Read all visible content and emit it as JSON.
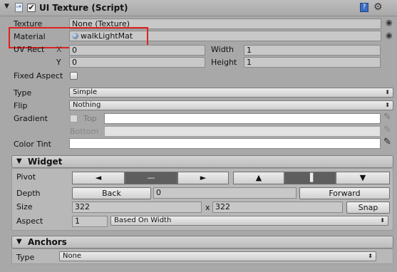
{
  "component": {
    "title": "UI Texture (Script)",
    "enabled": true,
    "icons": [
      "foldout-arrow-icon",
      "script-icon",
      "enable-checkbox",
      "help-icon",
      "settings-icon"
    ]
  },
  "texture": {
    "label": "Texture",
    "value": "None (Texture)"
  },
  "material": {
    "label": "Material",
    "value": "walkLightMat"
  },
  "uv_rect": {
    "label": "UV Rect",
    "x_label": "X",
    "x": "0",
    "y_label": "Y",
    "y": "0",
    "width_label": "Width",
    "width": "1",
    "height_label": "Height",
    "height": "1"
  },
  "fixed_aspect": {
    "label": "Fixed Aspect",
    "checked": false
  },
  "type": {
    "label": "Type",
    "value": "Simple"
  },
  "flip": {
    "label": "Flip",
    "value": "Nothing"
  },
  "gradient": {
    "label": "Gradient",
    "top_label": "Top",
    "bottom_label": "Bottom",
    "enabled": false
  },
  "color_tint": {
    "label": "Color Tint",
    "color": "#ffffff"
  },
  "widget": {
    "title": "Widget",
    "pivot_label": "Pivot",
    "pivot_h_left": "◄",
    "pivot_h_center": "—",
    "pivot_h_right": "►",
    "pivot_v_top": "▲",
    "pivot_v_middle": "▐",
    "pivot_v_bottom": "▼",
    "depth_label": "Depth",
    "back_label": "Back",
    "depth_value": "0",
    "forward_label": "Forward",
    "size_label": "Size",
    "size_w": "322",
    "size_x": "x",
    "size_h": "322",
    "snap_label": "Snap",
    "aspect_label": "Aspect",
    "aspect_value": "1",
    "aspect_mode": "Based On Width"
  },
  "anchors": {
    "title": "Anchors",
    "type_label": "Type",
    "type_value": "None"
  },
  "highlight_color": "#e02020"
}
